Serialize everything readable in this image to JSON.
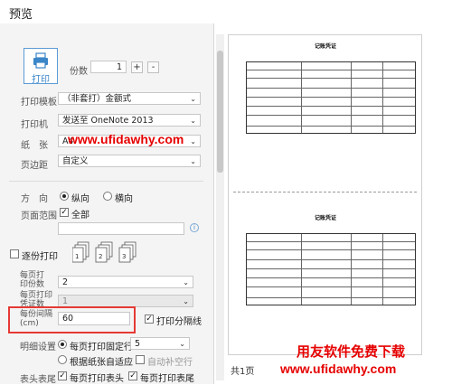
{
  "window": {
    "title": "预览"
  },
  "print": {
    "button_label": "打印",
    "copies_label": "份数",
    "copies_value": "1",
    "plus": "+",
    "minus": "-"
  },
  "template": {
    "label": "打印模板",
    "value": "（非套打）金额式"
  },
  "printer": {
    "label": "打印机",
    "value": "发送至 OneNote 2013"
  },
  "paper": {
    "label": "纸　张",
    "value": "A4"
  },
  "margin": {
    "label": "页边距",
    "value": "自定义"
  },
  "orientation": {
    "label": "方　向",
    "portrait": "纵向",
    "landscape": "横向",
    "selected": "portrait"
  },
  "page_range": {
    "label": "页面范围",
    "all_label": "全部",
    "all_checked": true,
    "range_value": "",
    "info_icon": "info-icon"
  },
  "collate": {
    "label": "逐份打印",
    "checked": false
  },
  "per_page": {
    "label": "每页打\n印份数",
    "value": "2"
  },
  "per_page_voucher": {
    "label": "每页打印\n凭证数",
    "value": "1"
  },
  "interval": {
    "label": "每份间隔\n(cm)",
    "value": "60",
    "separator_label": "打印分隔线",
    "separator_checked": true
  },
  "detail": {
    "label": "明细设置",
    "fixed_rows_label": "每页打印固定行",
    "fixed_rows_value": "5",
    "adaptive_label": "根据纸张自适应",
    "auto_fill_label": "自动补空行",
    "selected": "fixed"
  },
  "header_footer": {
    "label": "表头表尾",
    "print_header": "每页打印表头",
    "print_footer": "每页打印表尾"
  },
  "preview": {
    "page_count": "共1页",
    "voucher_title": "记账凭证"
  },
  "watermarks": {
    "top": "www.ufidawhy.com",
    "logo_text": "用友软件免费下载",
    "bottom": "www.ufidawhy.com"
  },
  "colors": {
    "accent": "#5b9bd5",
    "watermark": "#e60000",
    "highlight": "#e53935"
  }
}
